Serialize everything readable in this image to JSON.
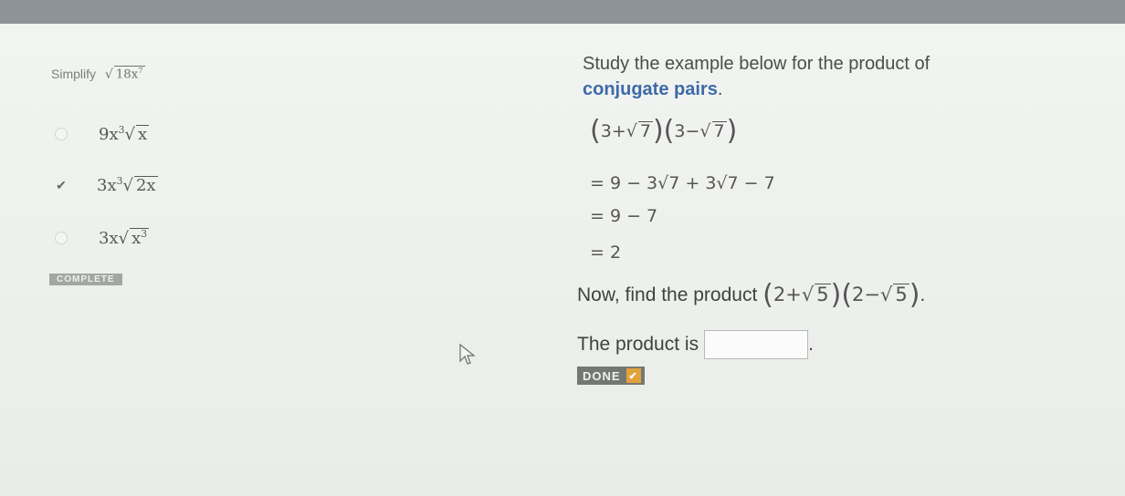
{
  "question": {
    "label": "Simplify",
    "radicand": "18x",
    "radicand_exp": "7"
  },
  "choices": [
    {
      "coef": "9x",
      "coef_exp": "3",
      "radicand": "x",
      "radicand_exp": "",
      "selected": false
    },
    {
      "coef": "3x",
      "coef_exp": "3",
      "radicand": "2x",
      "radicand_exp": "",
      "selected": true
    },
    {
      "coef": "3x",
      "coef_exp": "",
      "radicand": "x",
      "radicand_exp": "3",
      "selected": false
    }
  ],
  "complete_label": "COMPLETE",
  "instructions": {
    "line1": "Study the example below for the product of",
    "line2": "conjugate pairs",
    "line2_end": "."
  },
  "example": {
    "a": "3",
    "plus": "+",
    "minus": "−",
    "radicand": "7",
    "step1": "= 9 − 3√7 + 3√7 − 7",
    "step2": "= 9 − 7",
    "step3": "= 2"
  },
  "task": {
    "text": "Now, find the product",
    "a": "2",
    "radicand": "5",
    "end": "."
  },
  "answer": {
    "label": "The product is",
    "value": "",
    "end": "."
  },
  "done_button": {
    "label": "DONE",
    "icon": "check-icon"
  },
  "colors": {
    "topbar": "#8e9398",
    "accent_text": "#3d6aa8",
    "done_bg": "#747874",
    "done_icon_bg": "#e2a23a"
  }
}
